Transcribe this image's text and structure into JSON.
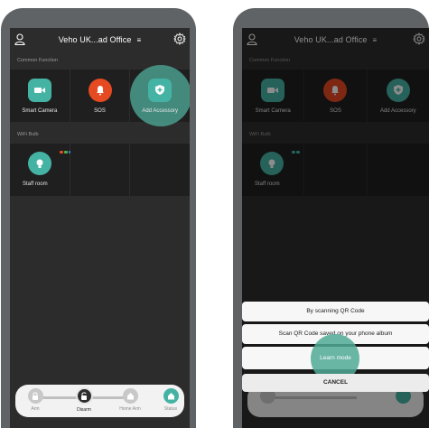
{
  "header": {
    "title": "Veho UK...ad Office",
    "menu_glyph": "≡"
  },
  "sections": {
    "common": "Common Function",
    "wifi": "WiFi Bulb"
  },
  "common_functions": [
    {
      "label": "Smart Camera",
      "icon": "camera-icon",
      "color": "#45b3a4"
    },
    {
      "label": "SOS",
      "icon": "alarm-bell-icon",
      "color": "#e64a23"
    },
    {
      "label": "Add Accessory",
      "icon": "shield-plus-icon",
      "color": "#45b3a4"
    }
  ],
  "wifi_bulbs": [
    {
      "label": "Staff room",
      "icon": "bulb-icon",
      "color": "#45b3a4"
    }
  ],
  "nav": [
    {
      "label": "Arm",
      "active": false
    },
    {
      "label": "Disarm",
      "active": true
    },
    {
      "label": "Home Arm",
      "active": false
    },
    {
      "label": "Status",
      "active": false
    }
  ],
  "sheet": {
    "options": [
      "By scanning QR Code",
      "Scan QR Code saved on your phone album",
      "Learn mode"
    ],
    "cancel": "CANCEL"
  },
  "colors": {
    "accent": "#45b3a4",
    "sos": "#e64a23",
    "phone_frame": "#5f6365",
    "screen_bg": "#2c2c2c",
    "tile_bg": "#1f1f1f"
  }
}
